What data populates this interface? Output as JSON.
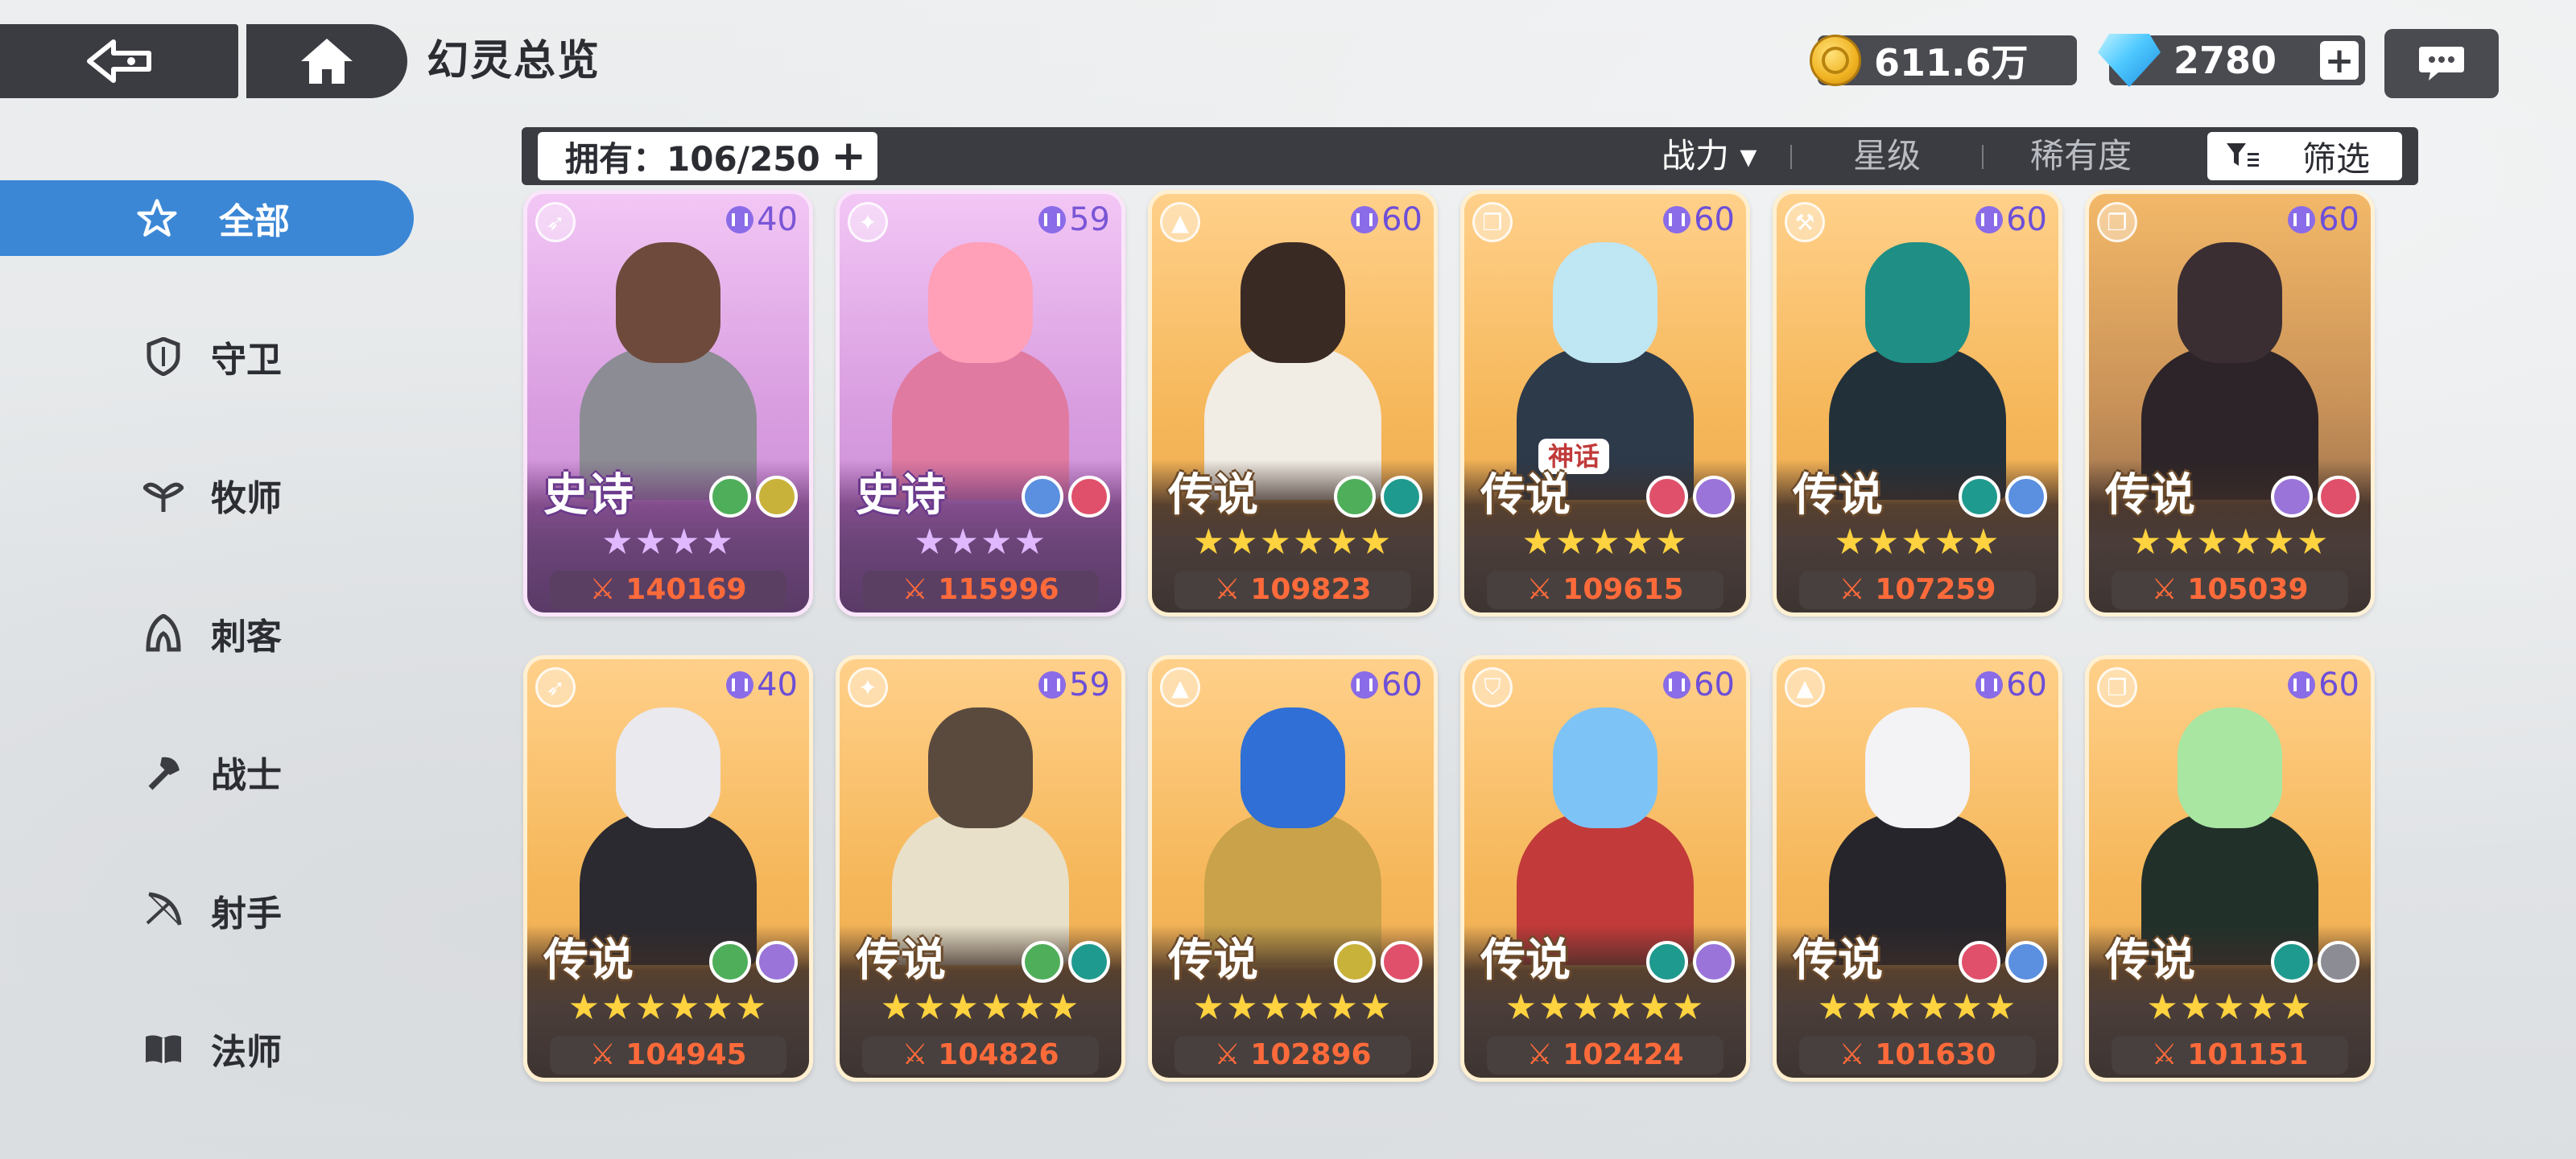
{
  "header": {
    "title": "幻灵总览",
    "gold": "611.6万",
    "gems": "2780",
    "gem_plus": "+"
  },
  "filter_bar": {
    "owned_label": "拥有：106/250",
    "owned_plus": "+",
    "sort_power": "战力 ▾",
    "sort_stars": "星级",
    "sort_rarity": "稀有度",
    "filter_label": "筛选"
  },
  "sidebar": {
    "items": [
      {
        "label": "全部",
        "icon": "star-outline-icon",
        "active": true
      },
      {
        "label": "守卫",
        "icon": "shield-icon",
        "active": false
      },
      {
        "label": "牧师",
        "icon": "priest-wings-icon",
        "active": false
      },
      {
        "label": "刺客",
        "icon": "assassin-hood-icon",
        "active": false
      },
      {
        "label": "战士",
        "icon": "warrior-axe-icon",
        "active": false
      },
      {
        "label": "射手",
        "icon": "bow-icon",
        "active": false
      },
      {
        "label": "法师",
        "icon": "spellbook-icon",
        "active": false
      }
    ]
  },
  "cards": [
    {
      "rarity": "史诗",
      "level": "40",
      "stars": "★★★★",
      "power": "140169",
      "theme": "purple",
      "class_icon": "bow-icon",
      "elements": [
        "leaf-element-icon",
        "wing-element-icon"
      ],
      "palette": [
        "#6d4a3b",
        "#8c8c94"
      ]
    },
    {
      "rarity": "史诗",
      "level": "59",
      "stars": "★★★★",
      "power": "115996",
      "theme": "purple",
      "class_icon": "priest-wings-icon",
      "elements": [
        "frost-element-icon",
        "fire-swirl-element-icon"
      ],
      "palette": [
        "#ff9fb8",
        "#e07aa0"
      ]
    },
    {
      "rarity": "传说",
      "level": "60",
      "stars": "★★★★★★",
      "power": "109823",
      "theme": "gold",
      "class_icon": "assassin-hood-icon",
      "elements": [
        "leaf-element-icon",
        "water-element-icon"
      ],
      "palette": [
        "#3a2a24",
        "#f1ece4"
      ]
    },
    {
      "rarity": "传说",
      "level": "60",
      "stars": "★★★★★",
      "power": "109615",
      "theme": "gold",
      "myth": "神话",
      "class_icon": "spellbook-icon",
      "elements": [
        "fire-swirl-element-icon",
        "void-element-icon"
      ],
      "palette": [
        "#bfe6f3",
        "#2d3a4a"
      ]
    },
    {
      "rarity": "传说",
      "level": "60",
      "stars": "★★★★★",
      "power": "107259",
      "theme": "gold",
      "class_icon": "warrior-axe-icon",
      "elements": [
        "water-element-icon",
        "frost-element-icon"
      ],
      "palette": [
        "#1f8e84",
        "#22303a"
      ]
    },
    {
      "rarity": "传说",
      "level": "60",
      "stars": "★★★★★★",
      "power": "105039",
      "theme": "dark",
      "class_icon": "spellbook-icon",
      "elements": [
        "void-element-icon",
        "fire-swirl-element-icon"
      ],
      "palette": [
        "#3a2e33",
        "#2c2428"
      ]
    },
    {
      "rarity": "传说",
      "level": "40",
      "stars": "★★★★★★",
      "power": "104945",
      "theme": "gold",
      "class_icon": "bow-icon",
      "elements": [
        "leaf-element-icon",
        "void-element-icon"
      ],
      "palette": [
        "#e9e9ee",
        "#2b2a30"
      ]
    },
    {
      "rarity": "传说",
      "level": "59",
      "stars": "★★★★★★",
      "power": "104826",
      "theme": "gold",
      "class_icon": "priest-wings-icon",
      "elements": [
        "leaf-element-icon",
        "water-element-icon"
      ],
      "palette": [
        "#5a4a3e",
        "#e8e0c8"
      ]
    },
    {
      "rarity": "传说",
      "level": "60",
      "stars": "★★★★★★",
      "power": "102896",
      "theme": "gold",
      "class_icon": "assassin-hood-icon",
      "elements": [
        "wing-element-icon",
        "fire-swirl-element-icon"
      ],
      "palette": [
        "#2f6fd6",
        "#c9a24a"
      ]
    },
    {
      "rarity": "传说",
      "level": "60",
      "stars": "★★★★★★",
      "power": "102424",
      "theme": "gold",
      "class_icon": "shield-icon",
      "elements": [
        "water-element-icon",
        "void-element-icon"
      ],
      "palette": [
        "#7ec3f5",
        "#c23a3a"
      ]
    },
    {
      "rarity": "传说",
      "level": "60",
      "stars": "★★★★★★",
      "power": "101630",
      "theme": "gold",
      "class_icon": "assassin-hood-icon",
      "elements": [
        "fire-swirl-element-icon",
        "frost-element-icon"
      ],
      "palette": [
        "#f3f3f6",
        "#26252b"
      ]
    },
    {
      "rarity": "传说",
      "level": "60",
      "stars": "★★★★★",
      "power": "101151",
      "theme": "gold",
      "class_icon": "spellbook-icon",
      "elements": [
        "water-element-icon",
        "spiral-element-icon"
      ],
      "palette": [
        "#a8e6a2",
        "#22302a"
      ]
    }
  ],
  "colors": {
    "accent": "#3b87d6",
    "bar_dark": "#3b3c41",
    "power_text": "#ff6a3a",
    "level_text": "#6d4fd8"
  }
}
